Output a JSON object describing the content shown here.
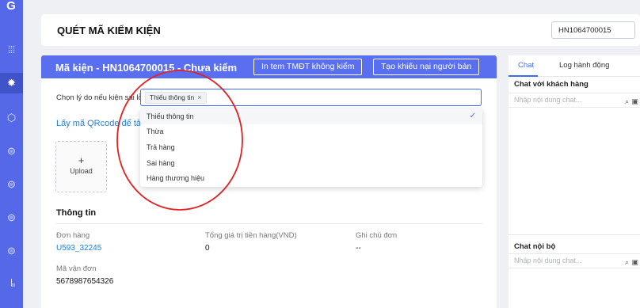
{
  "header": {
    "page_title": "QUÉT MÃ KIỂM KIỆN",
    "search_value": "HN1064700015"
  },
  "main": {
    "title": "Mã kiện - HN1064700015 - Chưa kiểm",
    "btn_print": "In tem TMĐT không kiểm",
    "btn_complaint": "Tạo khiếu nại người bán",
    "reason_label": "Chọn lý do nếu kiện sai lỗi:",
    "reason_tag": "Thiếu thông tin",
    "reason_tag_close": "×",
    "qr_link": "Lấy mã QRcode để tải",
    "upload_plus": "+",
    "upload_label": "Upload",
    "info_title": "Thông tin",
    "order_label": "Đơn hàng",
    "order_value": "U593_32245",
    "total_label": "Tổng giá trị tiền hàng(VND)",
    "total_value": "0",
    "note_label": "Ghi chú đơn",
    "note_value": "--",
    "waybill_label": "Mã vận đơn",
    "waybill_value": "5678987654326"
  },
  "dropdown": {
    "options": [
      "Thiếu thông tin",
      "Thừa",
      "Trả hàng",
      "Sai hàng",
      "Hàng thương hiệu"
    ],
    "selected_check": "✓"
  },
  "right_panel": {
    "tab_chat": "Chat",
    "tab_log": "Log hành động",
    "chat_customer_title": "Chat với khách hàng",
    "chat_customer_placeholder": "Nhập nội dung chat...",
    "chat_internal_title": "Chat nội bộ",
    "chat_internal_placeholder": "Nhập nội dung chat..."
  },
  "colors": {
    "sidebar": "#5468e8",
    "header_bar": "#5a6ff0",
    "accent_blue": "#3d6cf5",
    "link_blue": "#1d7fe6",
    "annotation_red": "#e32020"
  }
}
